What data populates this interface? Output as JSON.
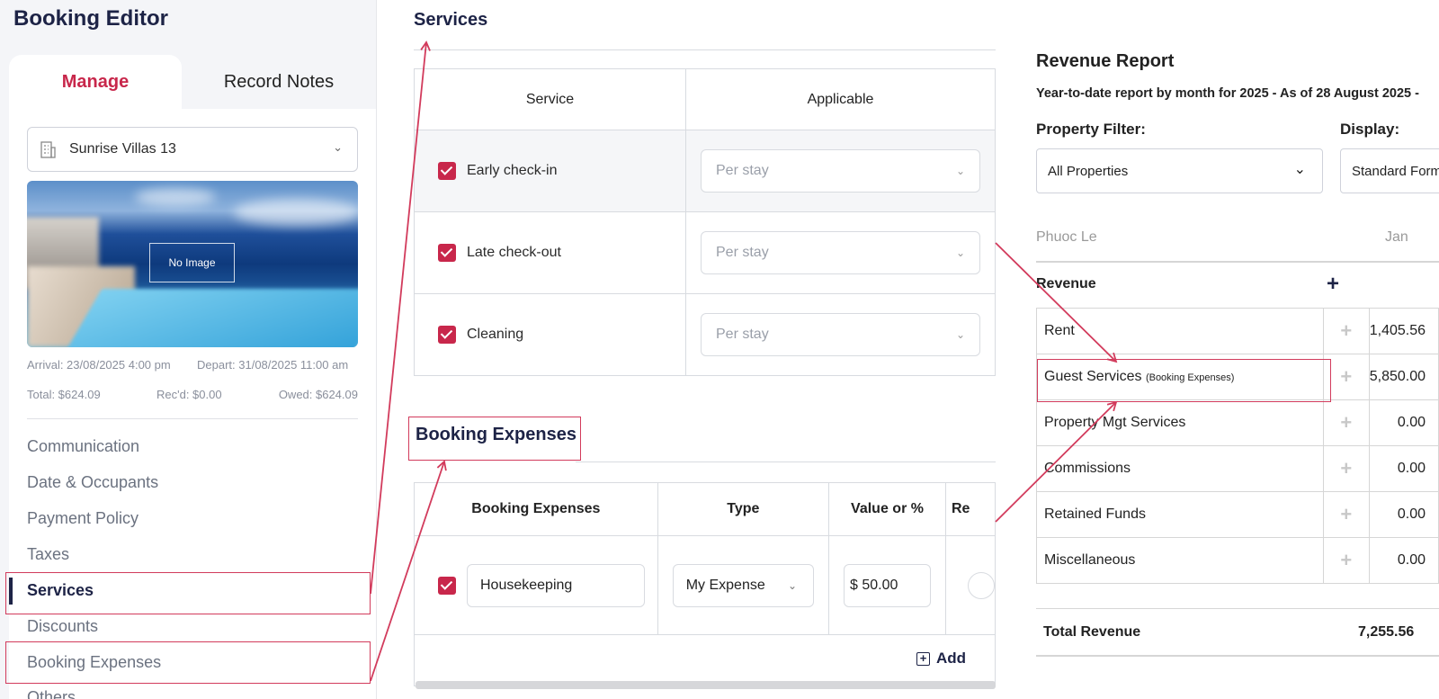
{
  "editor": {
    "title": "Booking Editor",
    "tabs": [
      "Manage",
      "Record Notes"
    ],
    "property": "Sunrise Villas 13",
    "photo_placeholder": "No Image",
    "arrival": "Arrival: 23/08/2025 4:00 pm",
    "depart": "Depart: 31/08/2025 11:00 am",
    "total": "Total: $624.09",
    "received": "Rec'd: $0.00",
    "owed": "Owed: $624.09",
    "nav": [
      "Communication",
      "Date & Occupants",
      "Payment Policy",
      "Taxes",
      "Services",
      "Discounts",
      "Booking Expenses",
      "Others"
    ],
    "active_nav": "Services"
  },
  "services": {
    "title": "Services",
    "columns": [
      "Service",
      "Applicable"
    ],
    "rows": [
      {
        "name": "Early check-in",
        "applicable": "Per stay",
        "checked": true
      },
      {
        "name": "Late check-out",
        "applicable": "Per stay",
        "checked": true
      },
      {
        "name": "Cleaning",
        "applicable": "Per stay",
        "checked": true
      }
    ]
  },
  "booking_expenses": {
    "title": "Booking Expenses",
    "columns": [
      "Booking Expenses",
      "Type",
      "Value or %",
      "Re"
    ],
    "rows": [
      {
        "name": "Housekeeping",
        "type": "My Expense",
        "value": "$ 50.00",
        "checked": true
      }
    ],
    "add_label": "Add"
  },
  "revenue_report": {
    "title": "Revenue Report",
    "subtitle": "Year-to-date report by month for 2025 - As of 28 August 2025 -",
    "property_filter_label": "Property Filter:",
    "property_filter_value": "All Properties",
    "display_label": "Display:",
    "display_value": "Standard Form",
    "owner": "Phuoc Le",
    "month_header": "Jan",
    "section_label": "Revenue",
    "rows": [
      {
        "name": "Rent",
        "note": "",
        "jan": "1,405.56"
      },
      {
        "name": "Guest Services",
        "note": "(Booking Expenses)",
        "jan": "5,850.00"
      },
      {
        "name": "Property Mgt Services",
        "note": "",
        "jan": "0.00"
      },
      {
        "name": "Commissions",
        "note": "",
        "jan": "0.00"
      },
      {
        "name": "Retained Funds",
        "note": "",
        "jan": "0.00"
      },
      {
        "name": "Miscellaneous",
        "note": "",
        "jan": "0.00"
      }
    ],
    "total_label": "Total Revenue",
    "total_jan": "7,255.56"
  },
  "colors": {
    "accent": "#c8274b",
    "navy": "#1d2346",
    "annotation": "#d23b5c"
  },
  "icons": [
    "building-icon",
    "chevron-down-icon",
    "check-icon",
    "plus-icon",
    "add-box-icon"
  ]
}
